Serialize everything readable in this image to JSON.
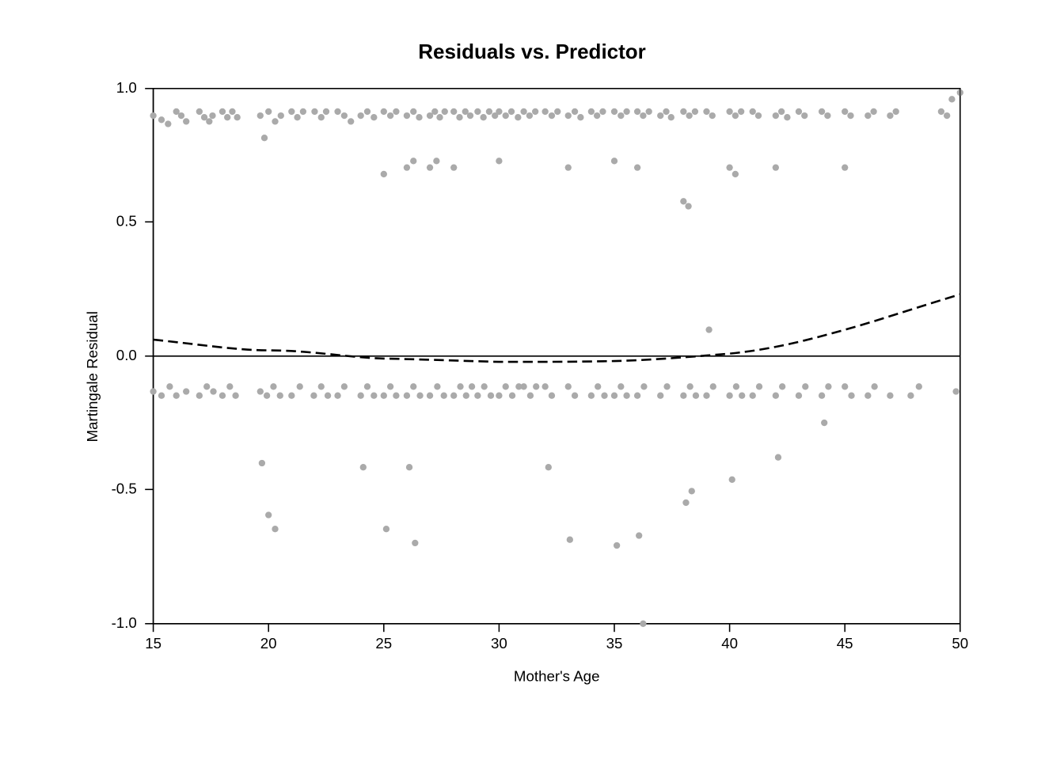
{
  "chart": {
    "title": "Residuals vs. Predictor",
    "x_axis_label": "Mother's Age",
    "y_axis_label": "Martingale Residual",
    "x_min": 15,
    "x_max": 50,
    "y_min": -1.0,
    "y_max": 1.0,
    "x_ticks": [
      15,
      20,
      25,
      30,
      35,
      40,
      45,
      50
    ],
    "y_ticks": [
      -1.0,
      -0.5,
      0.0,
      0.5,
      1.0
    ],
    "colors": {
      "dots": "#aaaaaa",
      "loess": "#000000",
      "zero_line": "#000000",
      "axis": "#000000",
      "background": "#ffffff"
    }
  }
}
